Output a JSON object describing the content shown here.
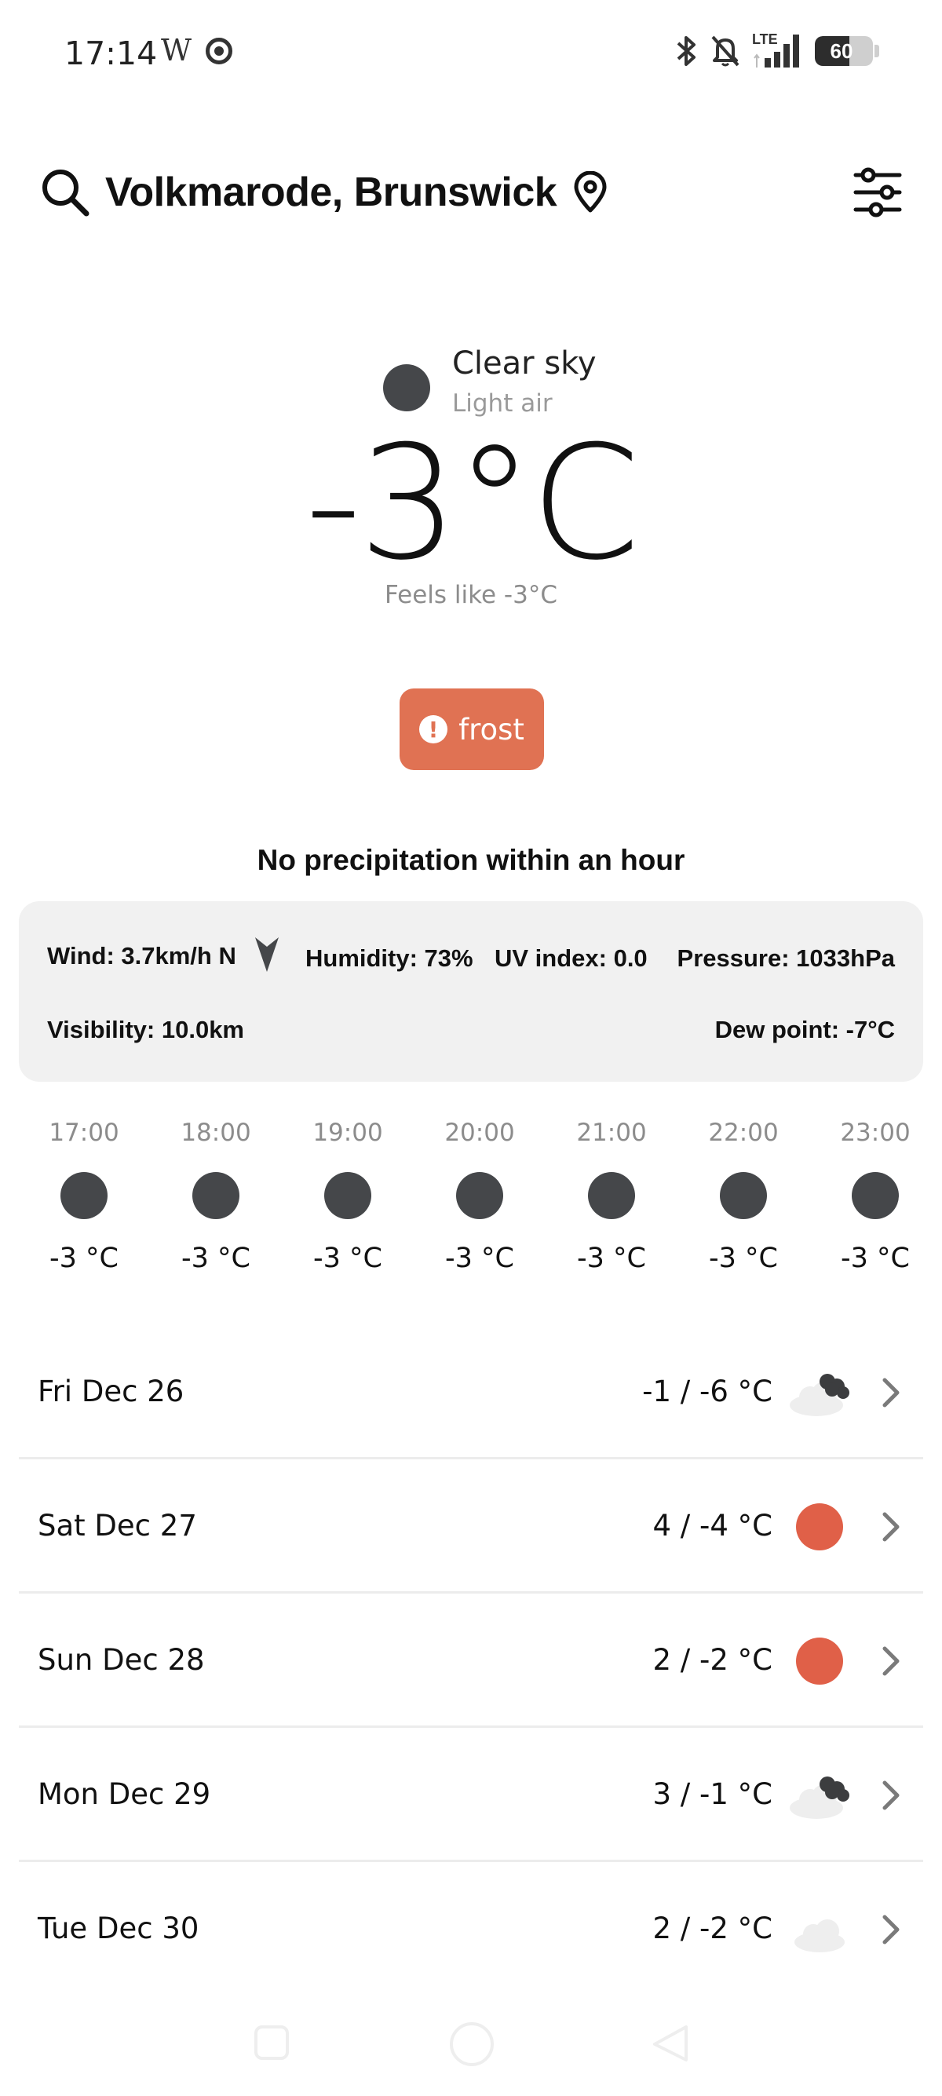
{
  "status_bar": {
    "time": "17:14",
    "app_glyph": "W",
    "network_label": "LTE",
    "battery": "60",
    "battery_level": 0.6,
    "icons": [
      "w-app-icon",
      "record-icon",
      "bluetooth-icon",
      "bell-muted-icon",
      "signal-icon",
      "battery-icon"
    ]
  },
  "header": {
    "location": "Volkmarode, Brunswick",
    "icons": [
      "search-icon",
      "location-pin-icon",
      "settings-sliders-icon"
    ]
  },
  "current": {
    "condition": "Clear sky",
    "wind_desc": "Light air",
    "temperature": "-3°C",
    "feels_like": "Feels like -3°C",
    "condition_color": "#45474a"
  },
  "alert": {
    "label": "frost",
    "color": "#e07253"
  },
  "precipitation": "No precipitation within an hour",
  "details": {
    "wind": "Wind: 3.7km/h N",
    "humidity": "Humidity: 73%",
    "uv": "UV index: 0.0",
    "pressure": "Pressure: 1033hPa",
    "visibility": "Visibility: 10.0km",
    "dew_point": "Dew point: -7°C"
  },
  "hourly": [
    {
      "time": "17:00",
      "temp": "-3 °C"
    },
    {
      "time": "18:00",
      "temp": "-3 °C"
    },
    {
      "time": "19:00",
      "temp": "-3 °C"
    },
    {
      "time": "20:00",
      "temp": "-3 °C"
    },
    {
      "time": "21:00",
      "temp": "-3 °C"
    },
    {
      "time": "22:00",
      "temp": "-3 °C"
    },
    {
      "time": "23:00",
      "temp": "-3 °C"
    }
  ],
  "daily": [
    {
      "day": "Fri Dec 26",
      "temp": "-1 / -6 °C",
      "icon": "cloud-dark-icon"
    },
    {
      "day": "Sat Dec 27",
      "temp": "4 / -4 °C",
      "icon": "sun-icon"
    },
    {
      "day": "Sun Dec 28",
      "temp": "2 / -2 °C",
      "icon": "sun-icon"
    },
    {
      "day": "Mon Dec 29",
      "temp": "3 / -1 °C",
      "icon": "cloud-dark-icon"
    },
    {
      "day": "Tue Dec 30",
      "temp": "2 / -2 °C",
      "icon": "cloud-light-icon"
    }
  ],
  "navbar": {
    "icons": [
      "recents-button",
      "home-button",
      "back-button"
    ]
  }
}
